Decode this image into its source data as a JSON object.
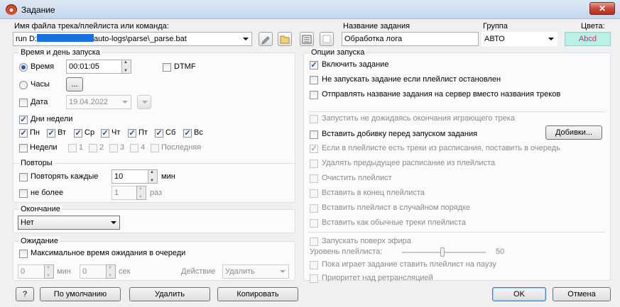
{
  "window": {
    "title": "Задание",
    "close_glyph": "✕"
  },
  "top": {
    "file_label": "Имя файла трека/плейлиста или команда:",
    "file_value_prefix": "run D:",
    "file_value_suffix": "auto-logs\\parse\\_parse.bat",
    "name_label": "Название задания",
    "name_value": "Обработка лога",
    "group_label": "Группа",
    "group_value": "АВТО",
    "colors_label": "Цвета:",
    "colors_value": "Abcd",
    "colors_bg": "#b8f2e6",
    "colors_fg": "#e0207a"
  },
  "schedule": {
    "title": "Время и день запуска",
    "time_label": "Время",
    "time_value": "00:01:05",
    "dtmf_label": "DTMF",
    "hours_label": "Часы",
    "hours_button": "...",
    "date_label": "Дата",
    "date_value": "19.04.2022",
    "weekdays_label": "Дни недели",
    "days": [
      "Пн",
      "Вт",
      "Ср",
      "Чт",
      "Пт",
      "Сб",
      "Вс"
    ],
    "weeks_label": "Недели",
    "weeks": [
      "1",
      "2",
      "3",
      "4",
      "Последняя"
    ]
  },
  "repeat": {
    "title": "Повторы",
    "every_label": "Повторять каждые",
    "every_value": "10",
    "every_unit": "мин",
    "max_label": "не более",
    "max_value": "1",
    "max_unit": "раз"
  },
  "ending": {
    "title": "Окончание",
    "value": "Нет"
  },
  "waiting": {
    "title": "Ожидание",
    "max_wait_label": "Максимальное время ожидания в очереди",
    "min_value": "0",
    "min_unit": "мин",
    "sec_value": "0",
    "sec_unit": "сек",
    "action_label": "Действие",
    "action_value": "Удалить"
  },
  "options": {
    "title": "Опции запуска",
    "items": [
      {
        "label": "Включить задание",
        "checked": true,
        "disabled": false
      },
      {
        "label": "Не запускать задание если плейлист остановлен",
        "checked": false,
        "disabled": false
      },
      {
        "label": "Отправлять название задания на сервер вместо названия треков",
        "checked": false,
        "disabled": false
      },
      {
        "label": "Запустить не дожидаясь окончания играющего трека",
        "checked": false,
        "disabled": true
      },
      {
        "label": "Вставить добивку перед запуском задания",
        "checked": false,
        "disabled": false
      },
      {
        "label": "Если в плейлисте есть треки из расписания, поставить в очередь",
        "checked": true,
        "disabled": true
      },
      {
        "label": "Удалять предыдущее расписание из плейлиста",
        "checked": false,
        "disabled": true
      },
      {
        "label": "Очистить плейлист",
        "checked": false,
        "disabled": true
      },
      {
        "label": "Вставить в конец плейлиста",
        "checked": false,
        "disabled": true
      },
      {
        "label": "Вставить плейлист в случайном порядке",
        "checked": false,
        "disabled": true
      },
      {
        "label": "Вставить как обычные треки плейлиста",
        "checked": false,
        "disabled": true
      },
      {
        "label": "Запускать поверх эфира",
        "checked": false,
        "disabled": true
      }
    ],
    "fillers_button": "Добивки...",
    "level_label": "Уровень плейлиста:",
    "level_value": "50",
    "pause_label": "Пока играет задание ставить плейлист на паузу",
    "priority_label": "Приоритет над ретрансляцией"
  },
  "buttons": {
    "help": "?",
    "default": "По умолчанию",
    "delete": "Удалить",
    "copy": "Копировать",
    "ok": "OK",
    "cancel": "Отмена"
  }
}
